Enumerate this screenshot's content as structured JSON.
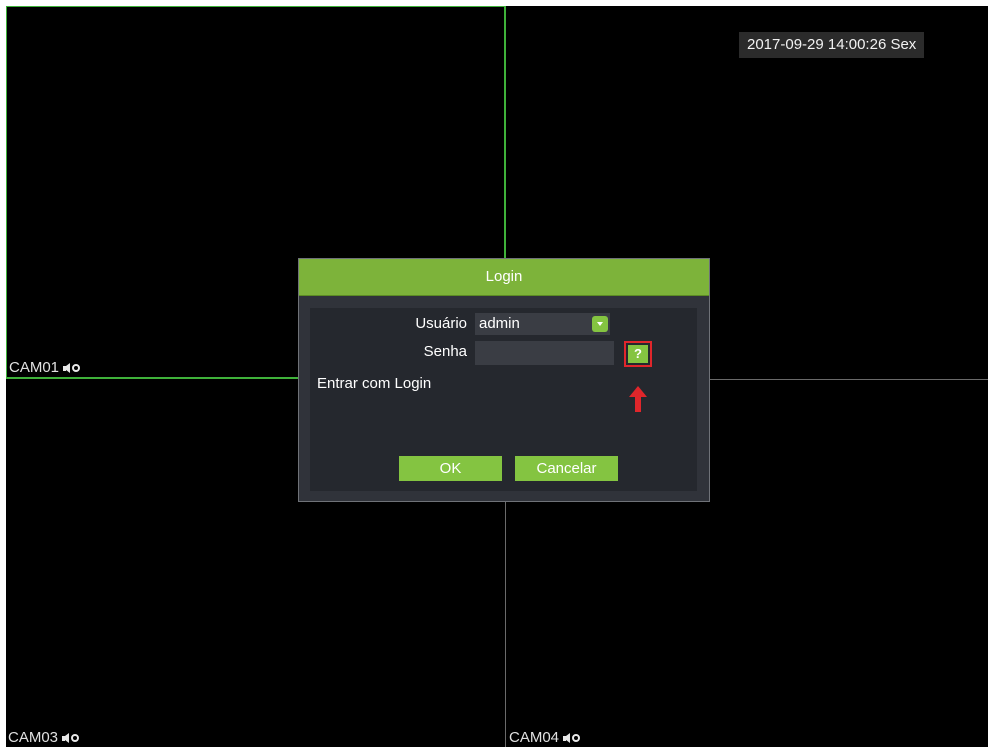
{
  "clock": {
    "datetime": "2017-09-29 14:00:26 Sex"
  },
  "cameras": [
    {
      "label": "CAM01"
    },
    {
      "label": ""
    },
    {
      "label": "CAM03"
    },
    {
      "label": "CAM04"
    }
  ],
  "login": {
    "title": "Login",
    "user_label": "Usuário",
    "user_value": "admin",
    "password_label": "Senha",
    "password_value": "",
    "help_label": "?",
    "login_mode": "Entrar com Login",
    "ok_label": "OK",
    "cancel_label": "Cancelar"
  },
  "colors": {
    "accent_green": "#84c441",
    "title_green": "#7db33a",
    "highlight_red": "#e0262b",
    "active_border": "#3fb23a"
  }
}
